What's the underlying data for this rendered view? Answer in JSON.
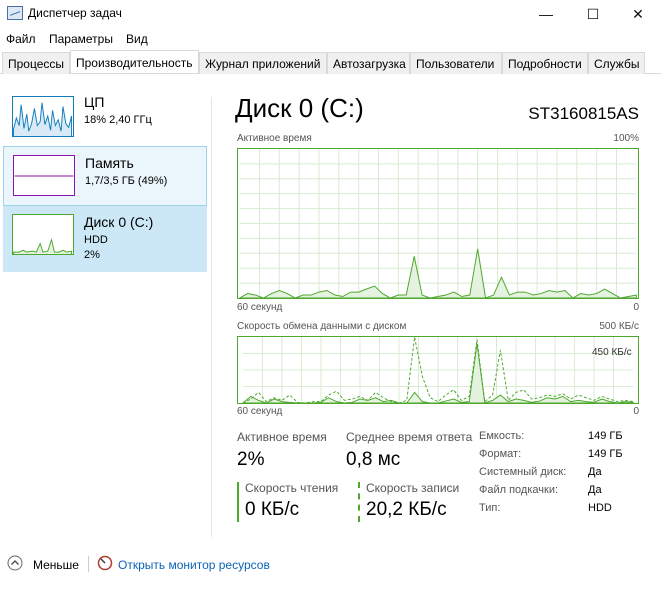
{
  "window": {
    "title": "Диспетчер задач",
    "minimize_glyph": "—",
    "maximize_glyph": "☐",
    "close_glyph": "✕"
  },
  "menu": [
    "Файл",
    "Параметры",
    "Вид"
  ],
  "tabs": [
    "Процессы",
    "Производительность",
    "Журнал приложений",
    "Автозагрузка",
    "Пользователи",
    "Подробности",
    "Службы"
  ],
  "active_tab": "Производительность",
  "sidebar": {
    "items": [
      {
        "title": "ЦП",
        "sub1": "18% 2,40 ГГц",
        "sub2": ""
      },
      {
        "title": "Память",
        "sub1": "1,7/3,5 ГБ (49%)",
        "sub2": ""
      },
      {
        "title": "Диск 0 (C:)",
        "sub1": "HDD",
        "sub2": "2%"
      }
    ]
  },
  "main": {
    "title": "Диск 0 (C:)",
    "model": "ST3160815AS",
    "graph1": {
      "label": "Активное время",
      "max": "100%",
      "time": "60 секунд",
      "min": "0",
      "values": [
        0,
        3,
        2,
        0,
        3,
        5,
        3,
        0,
        2,
        2,
        4,
        5,
        2,
        1,
        4,
        4,
        6,
        8,
        3,
        0,
        2,
        2,
        28,
        2,
        0,
        1,
        2,
        4,
        1,
        2,
        33,
        0,
        2,
        14,
        2,
        4,
        4,
        2,
        3,
        5,
        4,
        5,
        0,
        3,
        2,
        3,
        6,
        3,
        0,
        1,
        2
      ]
    },
    "graph2": {
      "label": "Скорость обмена данными с диском",
      "max": "500 КБ/с",
      "scale_inner": "450 КБ/с",
      "time": "60 секунд",
      "min": "0",
      "read": [
        0,
        50,
        20,
        0,
        30,
        10,
        5,
        0,
        0,
        0,
        5,
        40,
        10,
        0,
        5,
        30,
        20,
        40,
        10,
        20,
        0,
        0,
        80,
        10,
        0,
        0,
        15,
        30,
        5,
        10,
        450,
        0,
        20,
        60,
        10,
        30,
        20,
        5,
        15,
        40,
        30,
        50,
        10,
        20,
        10,
        5,
        30,
        10,
        0,
        10,
        5
      ],
      "write": [
        0,
        30,
        80,
        10,
        40,
        20,
        60,
        5,
        0,
        10,
        10,
        60,
        90,
        20,
        30,
        50,
        20,
        80,
        40,
        10,
        0,
        20,
        500,
        200,
        40,
        10,
        60,
        100,
        20,
        50,
        480,
        10,
        60,
        400,
        20,
        80,
        100,
        30,
        40,
        60,
        50,
        70,
        30,
        60,
        40,
        20,
        50,
        30,
        10,
        20,
        10
      ]
    },
    "stats": {
      "active_time_label": "Активное время",
      "active_time_value": "2%",
      "avg_response_label": "Среднее время ответа",
      "avg_response_value": "0,8 мс",
      "read_speed_label": "Скорость чтения",
      "read_speed_value": "0 КБ/с",
      "write_speed_label": "Скорость записи",
      "write_speed_value": "20,2 КБ/с"
    },
    "info": [
      {
        "label": "Емкость:",
        "value": "149 ГБ"
      },
      {
        "label": "Формат:",
        "value": "149 ГБ"
      },
      {
        "label": "Системный диск:",
        "value": "Да"
      },
      {
        "label": "Файл подкачки:",
        "value": "Да"
      },
      {
        "label": "Тип:",
        "value": "HDD"
      }
    ]
  },
  "footer": {
    "less_label": "Меньше",
    "monitor_label": "Открыть монитор ресурсов"
  },
  "colors": {
    "cpu": "#117dbb",
    "memory": "#8b12ae",
    "disk": "#4ea72e",
    "link": "#0a63b8"
  }
}
